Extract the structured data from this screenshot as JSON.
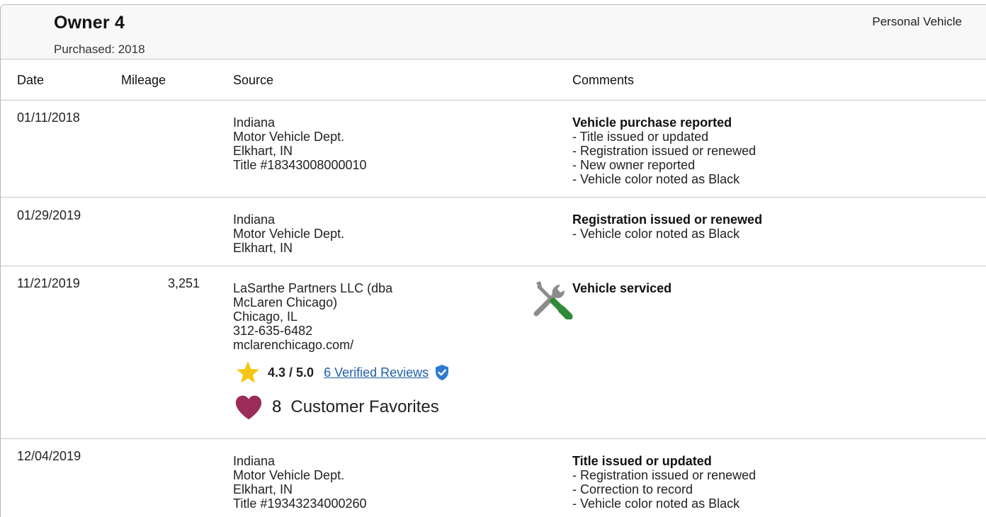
{
  "owner": {
    "title": "Owner 4",
    "purchased": "Purchased: 2018",
    "vehicle_type": "Personal Vehicle"
  },
  "columns": {
    "date": "Date",
    "mileage": "Mileage",
    "source": "Source",
    "comments": "Comments"
  },
  "rows": [
    {
      "date": "01/11/2018",
      "mileage": "",
      "source": [
        "Indiana",
        "Motor Vehicle Dept.",
        "Elkhart, IN",
        "Title #18343008000010"
      ],
      "comment_title": "Vehicle purchase reported",
      "comments": [
        "- Title issued or updated",
        "- Registration issued or renewed",
        "- New owner reported",
        "- Vehicle color noted as Black"
      ]
    },
    {
      "date": "01/29/2019",
      "mileage": "",
      "source": [
        "Indiana",
        "Motor Vehicle Dept.",
        "Elkhart, IN"
      ],
      "comment_title": "Registration issued or renewed",
      "comments": [
        "- Vehicle color noted as Black"
      ]
    },
    {
      "date": "11/21/2019",
      "mileage": "3,251",
      "source": [
        "LaSarthe Partners LLC (dba",
        "McLaren Chicago)",
        "Chicago, IL",
        "312-635-6482",
        "mclarenchicago.com/"
      ],
      "comment_title": "Vehicle serviced",
      "comments": [],
      "icon": "service-tools-icon",
      "rating": {
        "score": "4.3 / 5.0",
        "reviews_link": "6 Verified Reviews",
        "icon": "star-icon",
        "badge_icon": "verified-shield-icon"
      },
      "favorites": {
        "count": "8",
        "label": "Customer Favorites",
        "icon": "heart-icon"
      }
    },
    {
      "date": "12/04/2019",
      "mileage": "",
      "source": [
        "Indiana",
        "Motor Vehicle Dept.",
        "Elkhart, IN",
        "Title #19343234000260"
      ],
      "comment_title": "Title issued or updated",
      "comments": [
        "- Registration issued or renewed",
        "- Correction to record",
        "- Vehicle color noted as Black"
      ]
    }
  ],
  "colors": {
    "link": "#1f5fa8",
    "star": "#f5c518",
    "heart": "#9b2c57",
    "shield": "#2e7ad1",
    "wrench": "#8c8c8c",
    "screwdriver_handle": "#2f8a3a"
  }
}
